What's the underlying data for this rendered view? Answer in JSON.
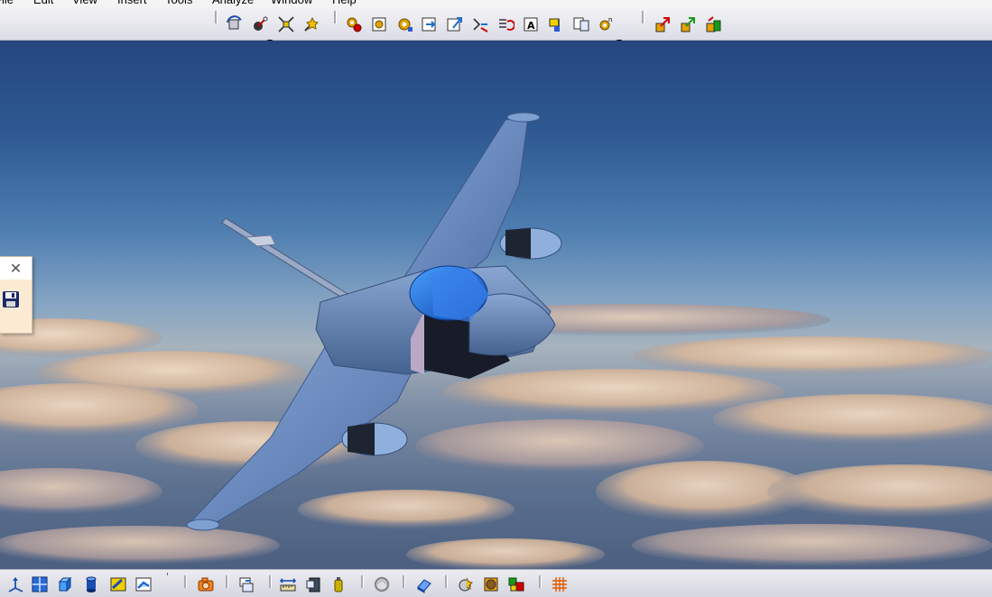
{
  "menu": {
    "items": [
      "File",
      "Edit",
      "View",
      "Insert",
      "Tools",
      "Analyze",
      "Window",
      "Help"
    ]
  },
  "top_toolbar": {
    "groups": [
      [
        "rotate-view-icon",
        "fly-mode-icon",
        "fit-all-icon",
        "normal-view-icon"
      ],
      [
        "gear-settings-icon",
        "gear-update-icon",
        "gear-options-icon",
        "insert-part-icon",
        "replace-component-icon",
        "snap-icon",
        "manage-representations-icon",
        "text-annotation-icon",
        "flag-note-icon",
        "multi-view-icon",
        "gear-catalog-icon"
      ],
      [
        "publish-icon",
        "publish-green-icon",
        "publish-check-icon"
      ]
    ]
  },
  "bottom_toolbar": {
    "icons": [
      "view-axis-icon",
      "multi-view-grid-icon",
      "iso-cube-icon",
      "cylinder-icon",
      "shading-icon",
      "shading-edges-icon",
      "capture-camera-icon",
      "swap-icon",
      "measure-ruler-icon",
      "measure-item-icon",
      "measure-inertia-icon",
      "hide-show-icon",
      "swap-visible-space-icon",
      "apply-material-icon",
      "render-style-icon",
      "scene-icon",
      "grid-snap-icon"
    ]
  },
  "floating_palette": {
    "close_glyph": "✕",
    "tool": "save-icon"
  },
  "colors": {
    "toolbar_bg": "#dcdce6",
    "palette_bg": "#fbebd3",
    "jet_body": "#6f90c2",
    "canopy": "#1f6fd6"
  }
}
